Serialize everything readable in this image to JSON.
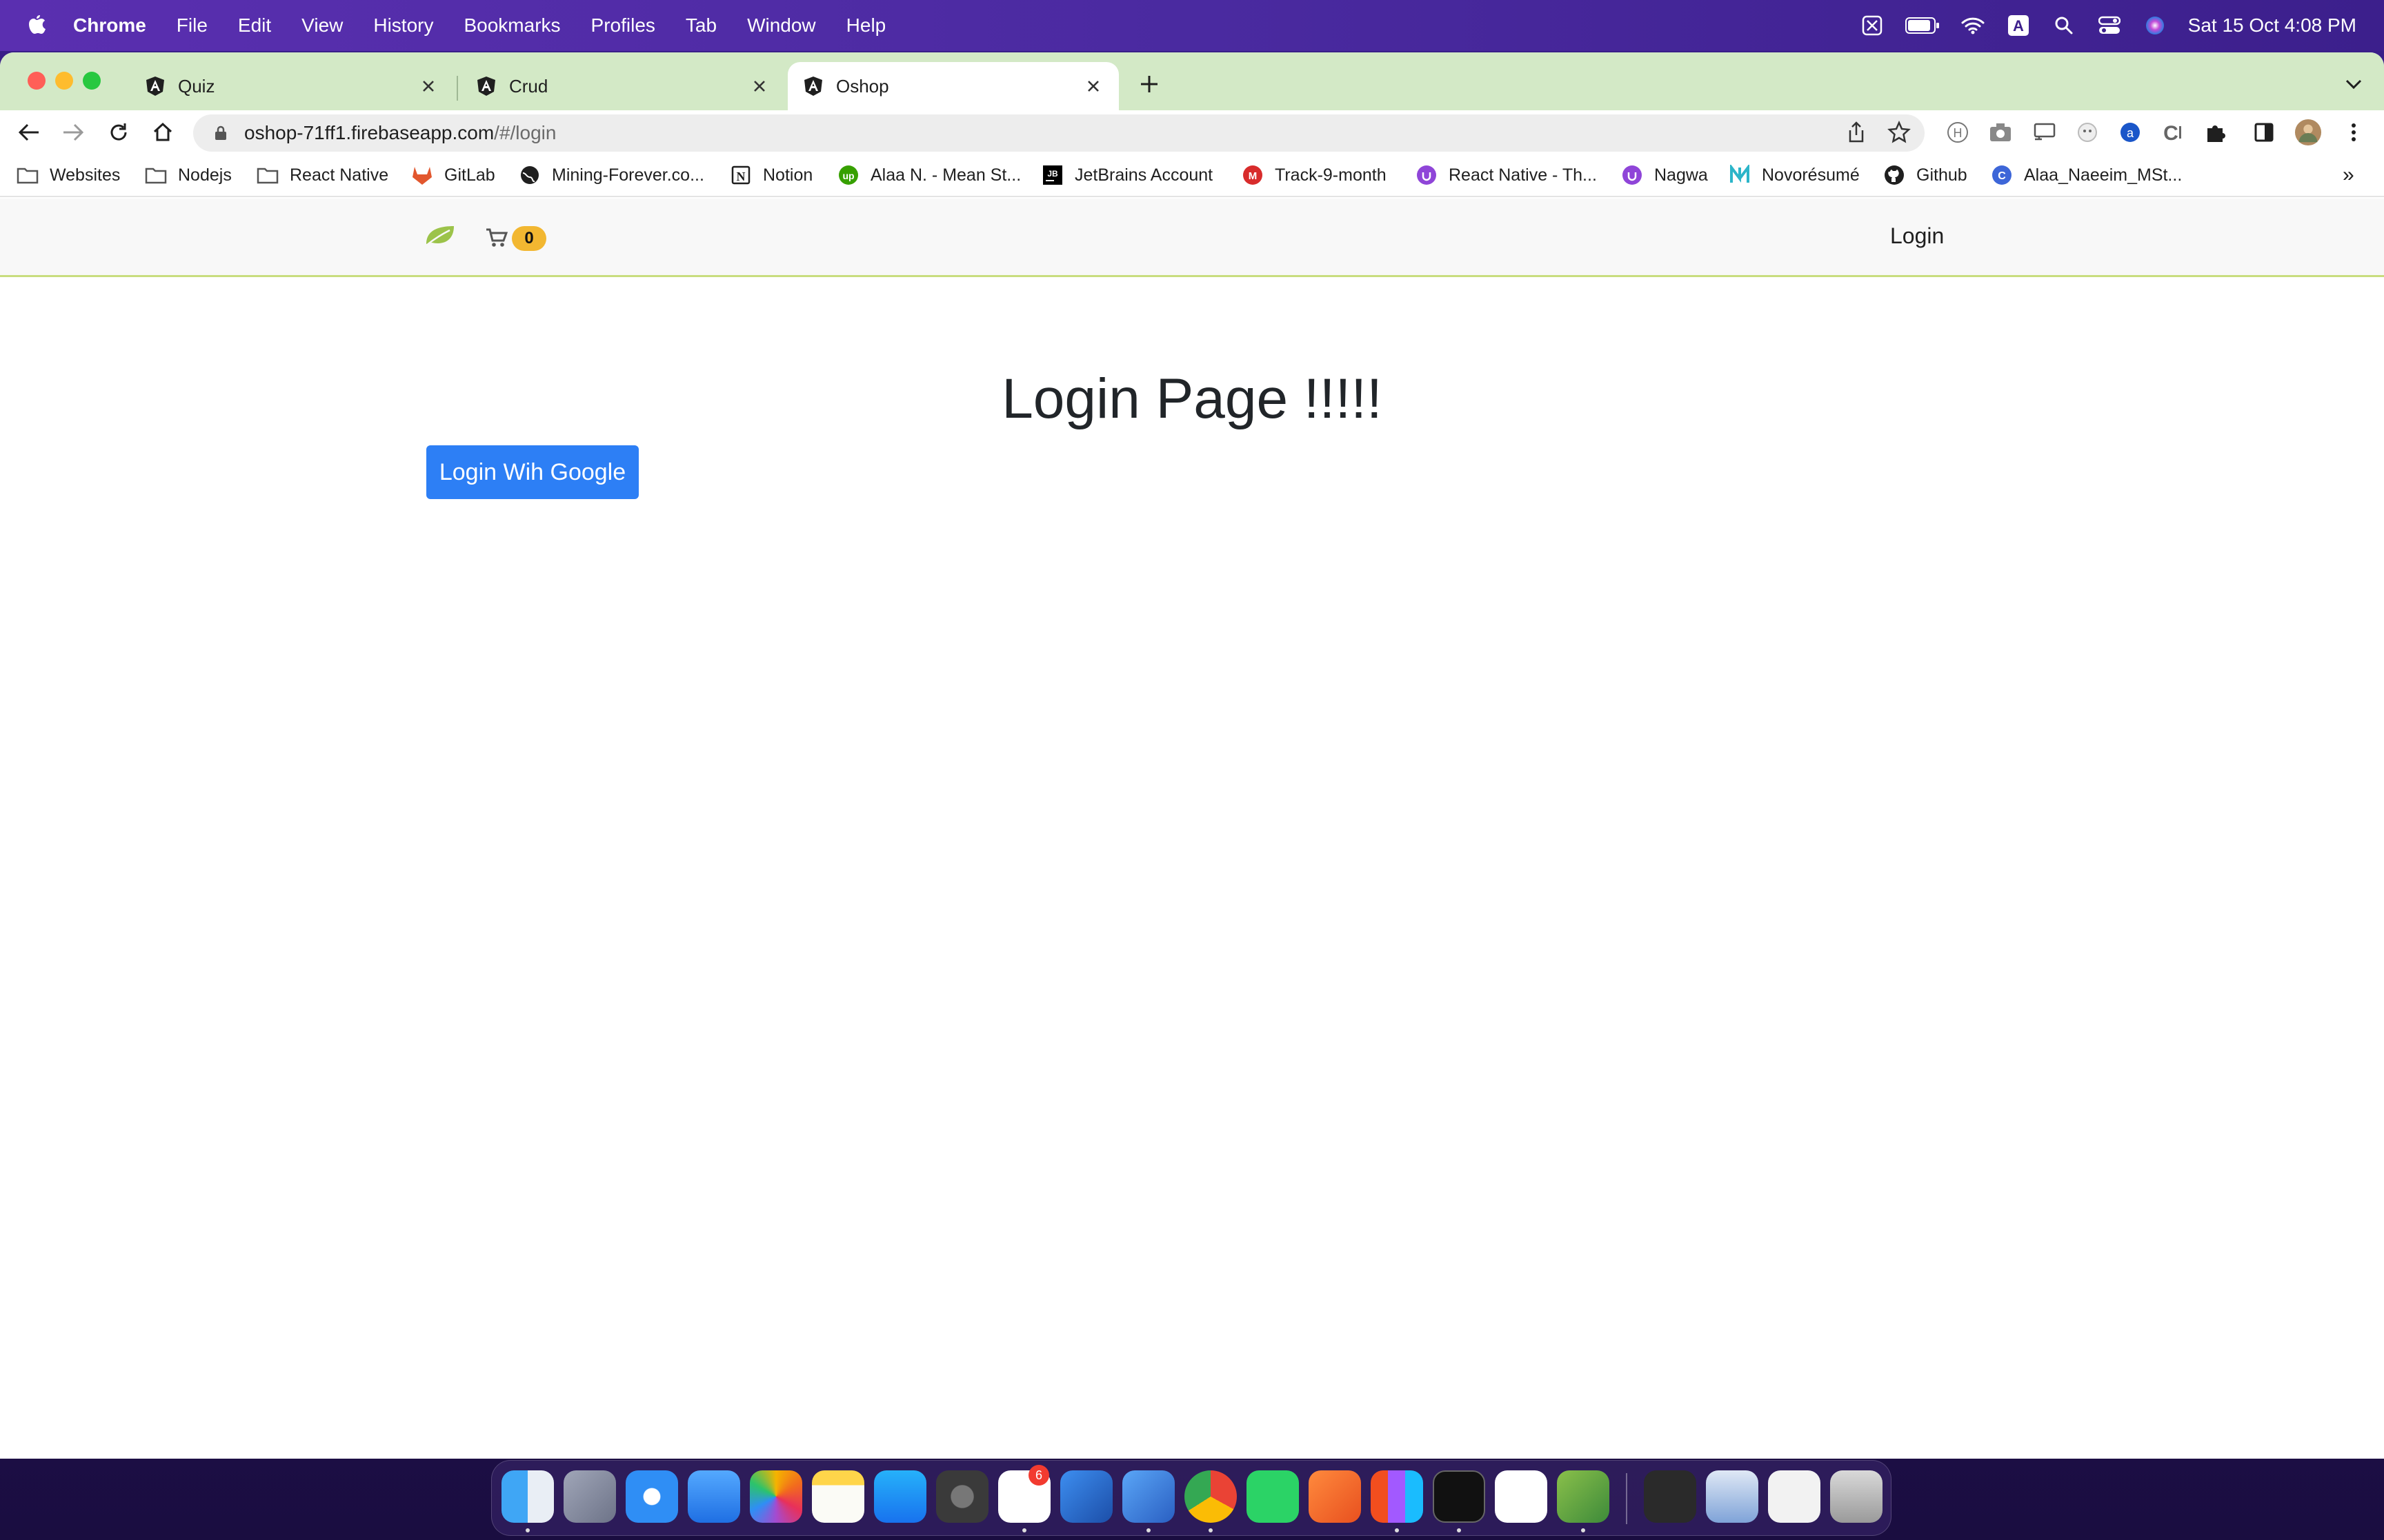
{
  "menubar": {
    "app": "Chrome",
    "items": [
      "File",
      "Edit",
      "View",
      "History",
      "Bookmarks",
      "Profiles",
      "Tab",
      "Window",
      "Help"
    ],
    "clock": "Sat 15 Oct  4:08 PM",
    "status_icons": [
      "screen-mirroring-icon",
      "battery-icon",
      "wifi-icon",
      "keyboard-input-icon",
      "spotlight-icon",
      "control-center-icon",
      "siri-icon"
    ]
  },
  "tabs": [
    {
      "title": "Quiz",
      "icon": "angular-icon"
    },
    {
      "title": "Crud",
      "icon": "angular-icon"
    },
    {
      "title": "Oshop",
      "icon": "angular-icon",
      "active": true
    }
  ],
  "omnibox": {
    "host": "oshop-71ff1.firebaseapp.com",
    "path": "/#/login"
  },
  "bookmarks": [
    {
      "label": "Websites",
      "icon": "folder-icon"
    },
    {
      "label": "Nodejs",
      "icon": "folder-icon"
    },
    {
      "label": "React Native",
      "icon": "folder-icon"
    },
    {
      "label": "GitLab",
      "icon": "gitlab-icon"
    },
    {
      "label": "Mining-Forever.co...",
      "icon": "globe-icon"
    },
    {
      "label": "Notion",
      "icon": "notion-icon"
    },
    {
      "label": "Alaa N. - Mean St...",
      "icon": "upwork-icon"
    },
    {
      "label": "JetBrains Account",
      "icon": "jetbrains-icon"
    },
    {
      "label": "Track-9-month",
      "icon": "track-icon"
    },
    {
      "label": "React Native - Th...",
      "icon": "udemy-icon"
    },
    {
      "label": "Nagwa",
      "icon": "udemy-icon"
    },
    {
      "label": "Novorésumé",
      "icon": "novoresume-icon"
    },
    {
      "label": "Github",
      "icon": "github-icon"
    },
    {
      "label": "Alaa_Naeeim_MSt...",
      "icon": "cv-icon"
    }
  ],
  "bookmarks_overflow": "»",
  "page": {
    "nav_login": "Login",
    "cart_count": "0",
    "title": "Login Page !!!!!",
    "google_button": "Login Wih Google"
  },
  "dock": {
    "apps": [
      "finder",
      "launchpad",
      "safari",
      "mail",
      "photos",
      "notes",
      "app-store",
      "system-preferences",
      "slack",
      "xcode",
      "simulator",
      "chrome",
      "whatsapp",
      "sketch",
      "figma",
      "terminal",
      "vscode",
      "android-studio"
    ],
    "slack_badge": "6"
  },
  "colors": {
    "tabbar": "#d3e9c6",
    "navbar_border": "#c8dd7e",
    "primary_button": "#2d7ff5",
    "cart_badge": "#f2b731"
  }
}
